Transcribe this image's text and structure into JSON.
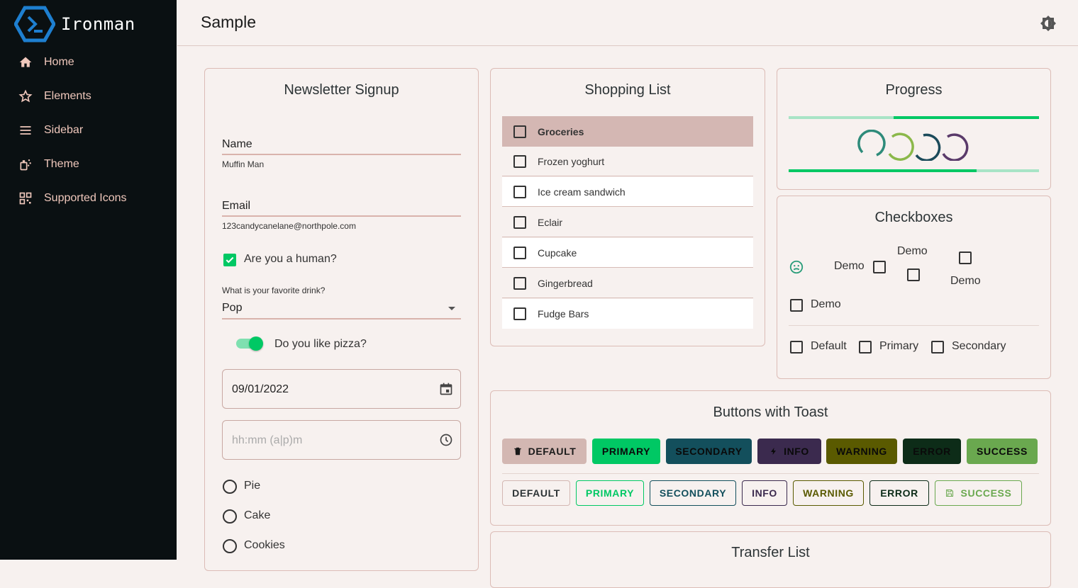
{
  "app": {
    "logo_text": "Ironman",
    "page_title": "Sample"
  },
  "sidebar": {
    "items": [
      {
        "label": "Home",
        "icon": "home-icon"
      },
      {
        "label": "Elements",
        "icon": "star-icon"
      },
      {
        "label": "Sidebar",
        "icon": "menu-icon"
      },
      {
        "label": "Theme",
        "icon": "palette-icon"
      },
      {
        "label": "Supported Icons",
        "icon": "qr-icon"
      }
    ]
  },
  "newsletter": {
    "title": "Newsletter Signup",
    "name_label": "Name",
    "name_value": "Muffin Man",
    "email_label": "Email",
    "email_value": "123candycanelane@northpole.com",
    "human_label": "Are you a human?",
    "human_checked": true,
    "drink_label": "What is your favorite drink?",
    "drink_value": "Pop",
    "pizza_label": "Do you like pizza?",
    "pizza_on": true,
    "date_value": "09/01/2022",
    "time_placeholder": "hh:mm (a|p)m",
    "radio_options": [
      "Pie",
      "Cake",
      "Cookies"
    ]
  },
  "shopping": {
    "title": "Shopping List",
    "header": "Groceries",
    "items": [
      "Frozen yoghurt",
      "Ice cream sandwich",
      "Eclair",
      "Cupcake",
      "Gingerbread",
      "Fudge Bars"
    ]
  },
  "progress": {
    "title": "Progress",
    "top_bar_fraction": 0.42,
    "bottom_bar_fraction": 0.75
  },
  "checkboxes": {
    "title": "Checkboxes",
    "demo": "Demo",
    "default": "Default",
    "primary": "Primary",
    "secondary": "Secondary"
  },
  "buttons": {
    "title": "Buttons with Toast",
    "filled": [
      "DEFAULT",
      "PRIMARY",
      "SECONDARY",
      "INFO",
      "WARNING",
      "ERROR",
      "SUCCESS"
    ],
    "outlined": [
      "DEFAULT",
      "PRIMARY",
      "SECONDARY",
      "INFO",
      "WARNING",
      "ERROR",
      "SUCCESS"
    ]
  },
  "transfer": {
    "title": "Transfer List"
  },
  "colors": {
    "primary": "#00c864",
    "secondary": "#134f5c",
    "info": "#3b2a4e",
    "warning": "#5a5a00",
    "error": "#0d2c18",
    "success": "#6aa84f",
    "default": "#d3b7b2"
  }
}
